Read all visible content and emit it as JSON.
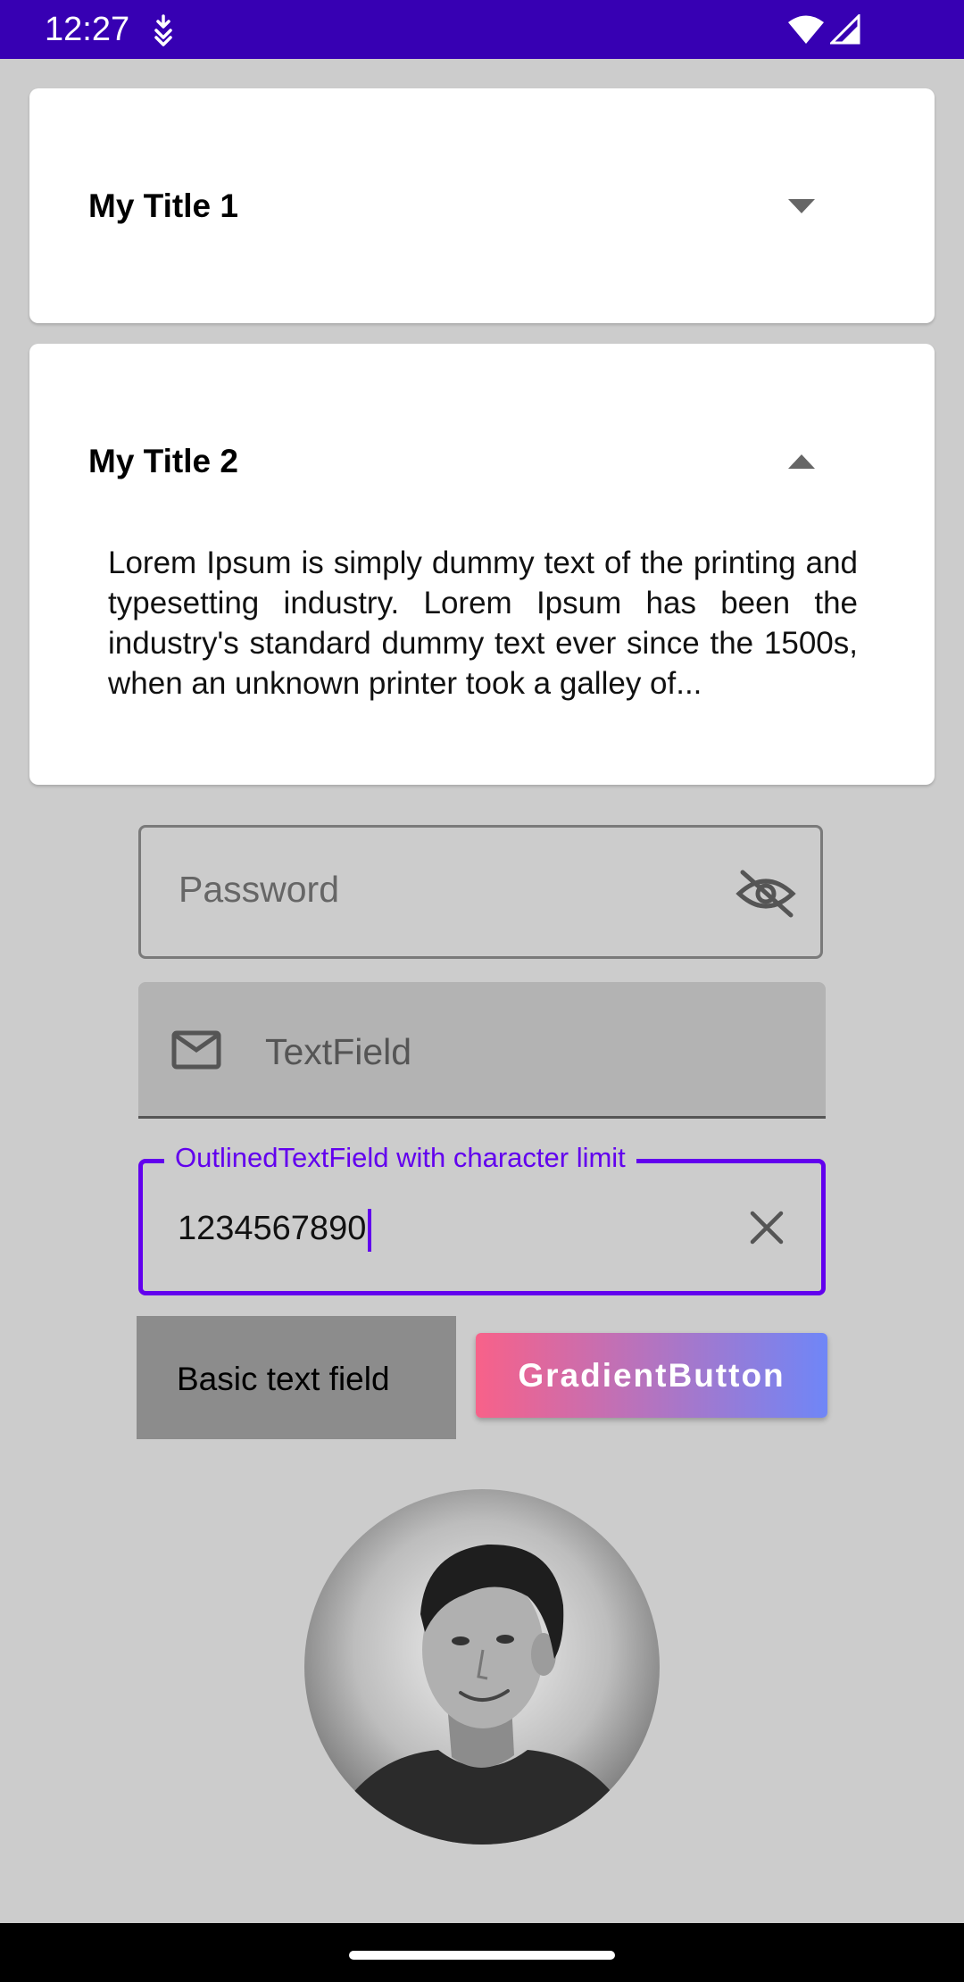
{
  "status_bar": {
    "time": "12:27",
    "icons": [
      "download-notification-icon",
      "wifi-icon",
      "cellular-signal-icon"
    ]
  },
  "accordion": [
    {
      "title": "My Title 1",
      "expanded": false,
      "icon": "caret-down-icon"
    },
    {
      "title": "My Title 2",
      "expanded": true,
      "icon": "caret-up-icon",
      "body": "Lorem Ipsum is simply dummy text of the printing and typesetting industry. Lorem Ipsum has been the industry's standard dummy text ever since the 1500s, when an unknown printer took a galley of..."
    }
  ],
  "password_field": {
    "placeholder": "Password",
    "icon": "visibility-off-icon"
  },
  "text_field": {
    "placeholder": "TextField",
    "icon": "mail-icon"
  },
  "outlined_field": {
    "label": "OutlinedTextField with character limit",
    "value": "1234567890",
    "icon": "close-icon",
    "accent": "#6200ee"
  },
  "basic_field": {
    "value": "Basic text field"
  },
  "gradient_button": {
    "label": "GradientButton",
    "colors": [
      "#f86189",
      "#6f86f7"
    ]
  },
  "avatar": {
    "icon": "profile-photo"
  },
  "colors": {
    "status_bar": "#3700b3",
    "background": "#cccccc",
    "accent": "#6200ee"
  }
}
